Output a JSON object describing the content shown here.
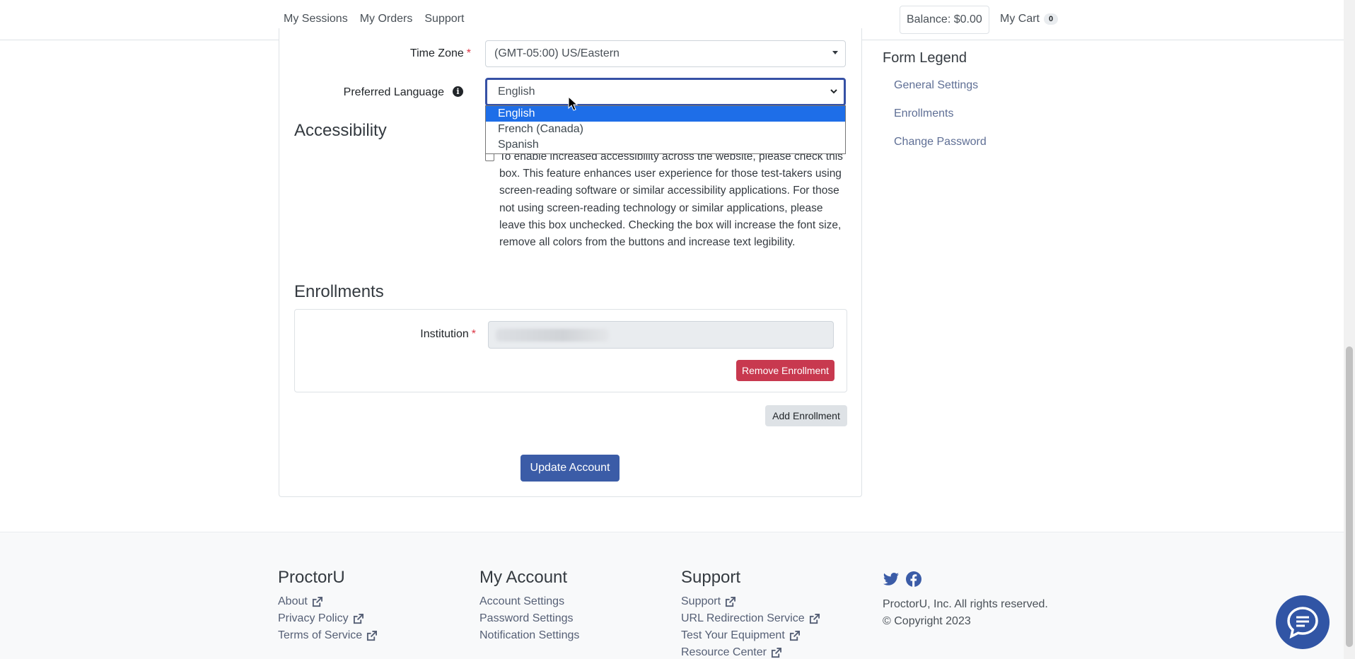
{
  "nav": {
    "links": [
      "My Sessions",
      "My Orders",
      "Support"
    ],
    "balance": "Balance: $0.00",
    "cart_label": "My Cart",
    "cart_count": "0"
  },
  "form": {
    "timezone": {
      "label": "Time Zone",
      "value": "(GMT-05:00) US/Eastern"
    },
    "language": {
      "label": "Preferred Language",
      "value": "English",
      "options": [
        "English",
        "French (Canada)",
        "Spanish"
      ]
    },
    "accessibility": {
      "title": "Accessibility",
      "text": "To enable increased accessibility across the website, please check this box. This feature enhances user experience for those test-takers using screen-reading software or similar accessibility applications. For those not using screen-reading technology or similar applications, please leave this box unchecked. Checking the box will increase the font size, remove all colors from the buttons and increase text legibility."
    },
    "enrollments": {
      "title": "Enrollments",
      "institution_label": "Institution",
      "remove_label": "Remove Enrollment",
      "add_label": "Add Enrollment"
    },
    "update_label": "Update Account"
  },
  "legend": {
    "title": "Form Legend",
    "links": [
      "General Settings",
      "Enrollments",
      "Change Password"
    ]
  },
  "footer": {
    "proctoru": {
      "title": "ProctorU",
      "links": [
        "About",
        "Privacy Policy",
        "Terms of Service"
      ]
    },
    "account": {
      "title": "My Account",
      "links": [
        "Account Settings",
        "Password Settings",
        "Notification Settings"
      ]
    },
    "support": {
      "title": "Support",
      "links": [
        "Support",
        "URL Redirection Service",
        "Test Your Equipment",
        "Resource Center"
      ]
    },
    "company": {
      "rights": "ProctorU, Inc. All rights reserved.",
      "copyright": "© Copyright 2023"
    }
  },
  "colors": {
    "primary": "#3b5ca7",
    "danger": "#c8394f",
    "focus": "#3651a5",
    "highlight": "#1e6ee8"
  }
}
